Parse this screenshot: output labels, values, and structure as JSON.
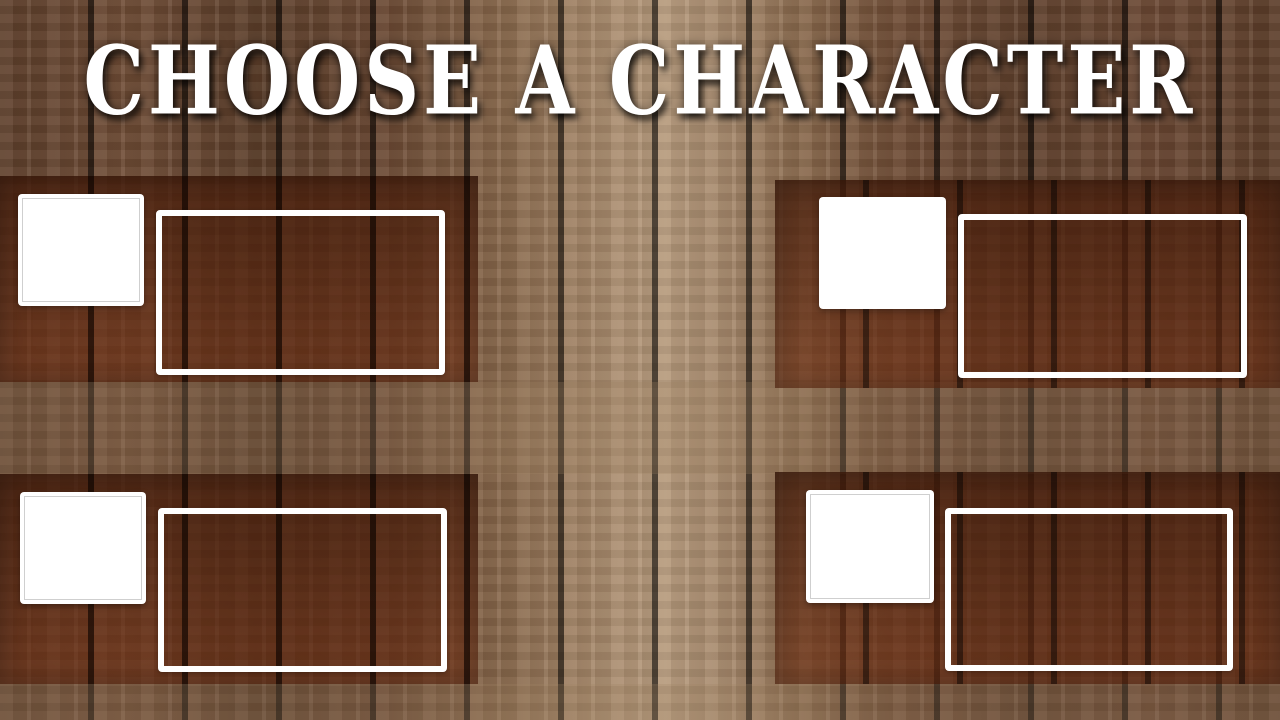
{
  "screen": {
    "title": "CHOOSE A CHARACTER"
  },
  "character_slots": [
    {
      "id": "slot-1",
      "position": "top-left",
      "portrait": "",
      "info": ""
    },
    {
      "id": "slot-2",
      "position": "top-right",
      "portrait": "",
      "info": ""
    },
    {
      "id": "slot-3",
      "position": "bottom-left",
      "portrait": "",
      "info": ""
    },
    {
      "id": "slot-4",
      "position": "bottom-right",
      "portrait": "",
      "info": ""
    }
  ],
  "colors": {
    "wood": "#6b4a34",
    "frame": "#ffffff",
    "title": "#ffffff"
  }
}
